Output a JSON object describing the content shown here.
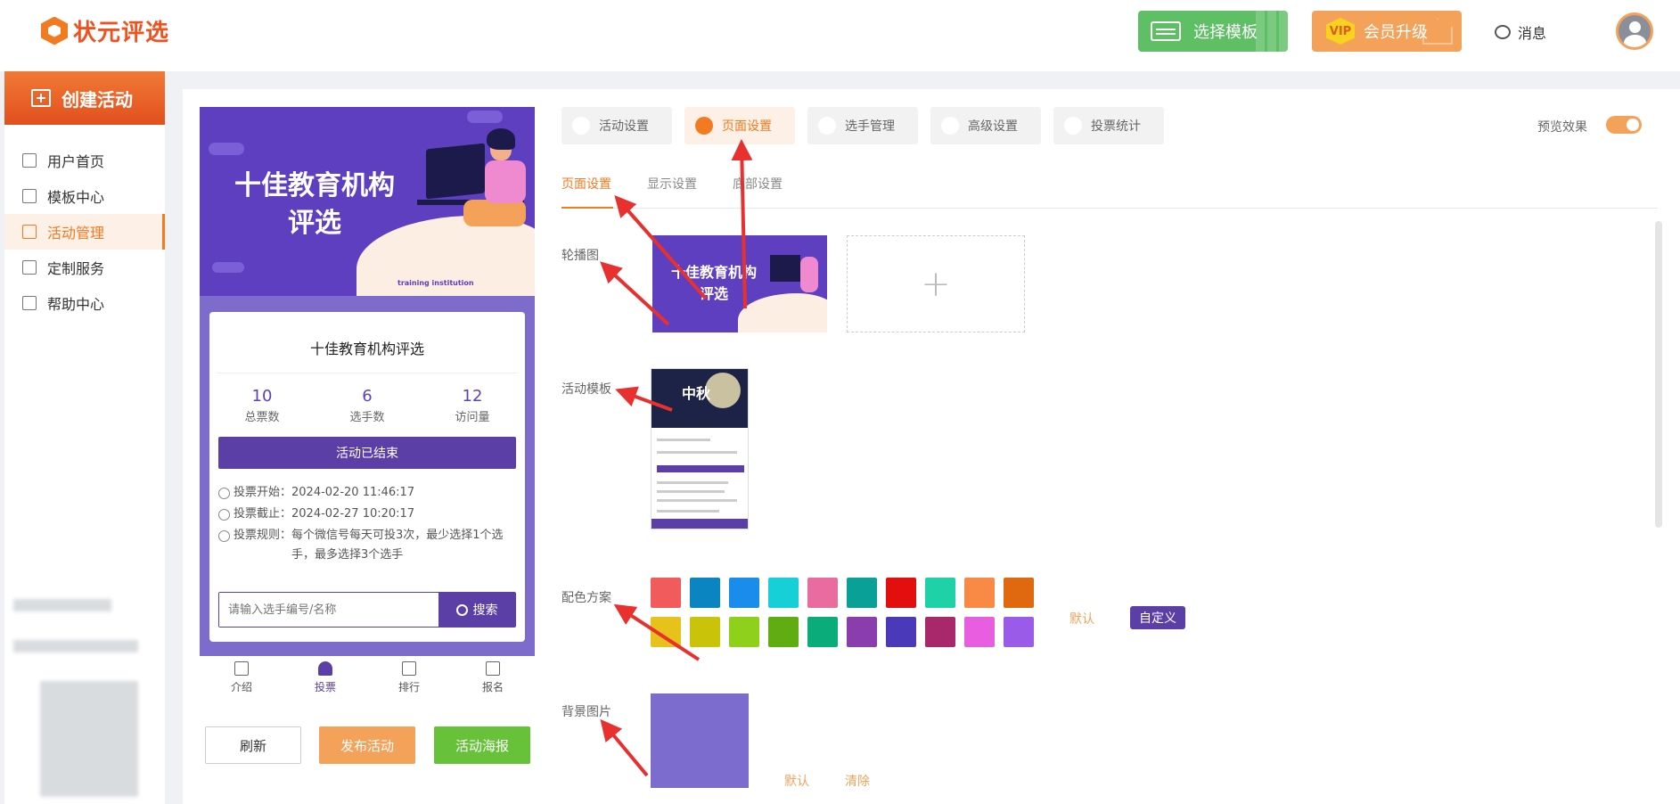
{
  "header": {
    "logo_text": "状元评选",
    "select_template": "选择模板",
    "vip_badge": "VIP",
    "vip_upgrade": "会员升级",
    "messages": "消息"
  },
  "sidebar": {
    "create": "创建活动",
    "items": [
      {
        "label": "用户首页",
        "icon": "home-icon"
      },
      {
        "label": "模板中心",
        "icon": "folder-icon"
      },
      {
        "label": "活动管理",
        "icon": "ticket-icon",
        "active": true
      },
      {
        "label": "定制服务",
        "icon": "tools-icon"
      },
      {
        "label": "帮助中心",
        "icon": "book-icon"
      }
    ]
  },
  "preview": {
    "banner_title": "十佳教育机构评选",
    "banner_subtitle": "training institution",
    "card_title": "十佳教育机构评选",
    "stats": [
      {
        "num": "10",
        "label": "总票数"
      },
      {
        "num": "6",
        "label": "选手数"
      },
      {
        "num": "12",
        "label": "访问量"
      }
    ],
    "ended_button": "活动已结束",
    "vote_start_label": "投票开始：",
    "vote_start_value": "2024-02-20 11:46:17",
    "vote_end_label": "投票截止：",
    "vote_end_value": "2024-02-27 10:20:17",
    "rules_label": "投票规则：",
    "rules_value": "每个微信号每天可投3次，最少选择1个选手，最多选择3个选手",
    "search_placeholder": "请输入选手编号/名称",
    "search_button": "搜索",
    "tabs": [
      "介绍",
      "投票",
      "排行",
      "报名"
    ]
  },
  "actions": {
    "refresh": "刷新",
    "publish": "发布活动",
    "poster": "活动海报"
  },
  "settings": {
    "top_tabs": [
      "活动设置",
      "页面设置",
      "选手管理",
      "高级设置",
      "投票统计"
    ],
    "active_top_tab": 1,
    "preview_label": "预览效果",
    "sub_tabs": [
      "页面设置",
      "显示设置",
      "底部设置"
    ],
    "carousel_label": "轮播图",
    "carousel_image_title": "十佳教育机构评选",
    "template_label": "活动模板",
    "template_title": "中秋",
    "color_label": "配色方案",
    "colors_row1": [
      "#f25b5b",
      "#0a85c2",
      "#1a8ceb",
      "#17cfd6",
      "#e86c9e",
      "#08a097",
      "#e30f0f",
      "#1ed1a6",
      "#f98a45",
      "#e0680f"
    ],
    "colors_row2": [
      "#e6c21a",
      "#c9c40a",
      "#8fd11a",
      "#5fad10",
      "#0aad7a",
      "#8a3dad",
      "#4a3aba",
      "#a8286b",
      "#e85ee0",
      "#9a5ce8"
    ],
    "default_link": "默认",
    "custom_button": "自定义",
    "bg_label": "背景图片",
    "bg_default": "默认",
    "bg_clear": "清除"
  }
}
